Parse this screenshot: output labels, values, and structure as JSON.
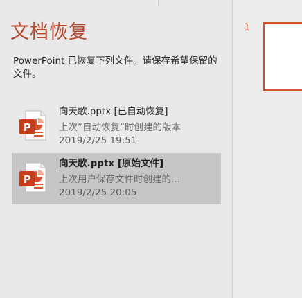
{
  "panel": {
    "title": "文档恢复",
    "description": "PowerPoint 已恢复下列文件。请保存希望保留的文件。"
  },
  "files": [
    {
      "name": "向天歌.pptx  [已自动恢复]",
      "note": "上次“自动恢复”时创建的版本",
      "time": "2019/2/25 19:51",
      "selected": false
    },
    {
      "name": "向天歌.pptx  [原始文件]",
      "note": "上次用户保存文件时创建的...",
      "time": "2019/2/25 20:05",
      "selected": true
    }
  ],
  "thumbnails": {
    "slide_number": "1"
  },
  "icons": {
    "file_icon": "powerpoint-file-icon"
  },
  "colors": {
    "accent": "#b7472a",
    "thumb_border": "#d35230",
    "selected_bg": "#c6c6c6"
  }
}
